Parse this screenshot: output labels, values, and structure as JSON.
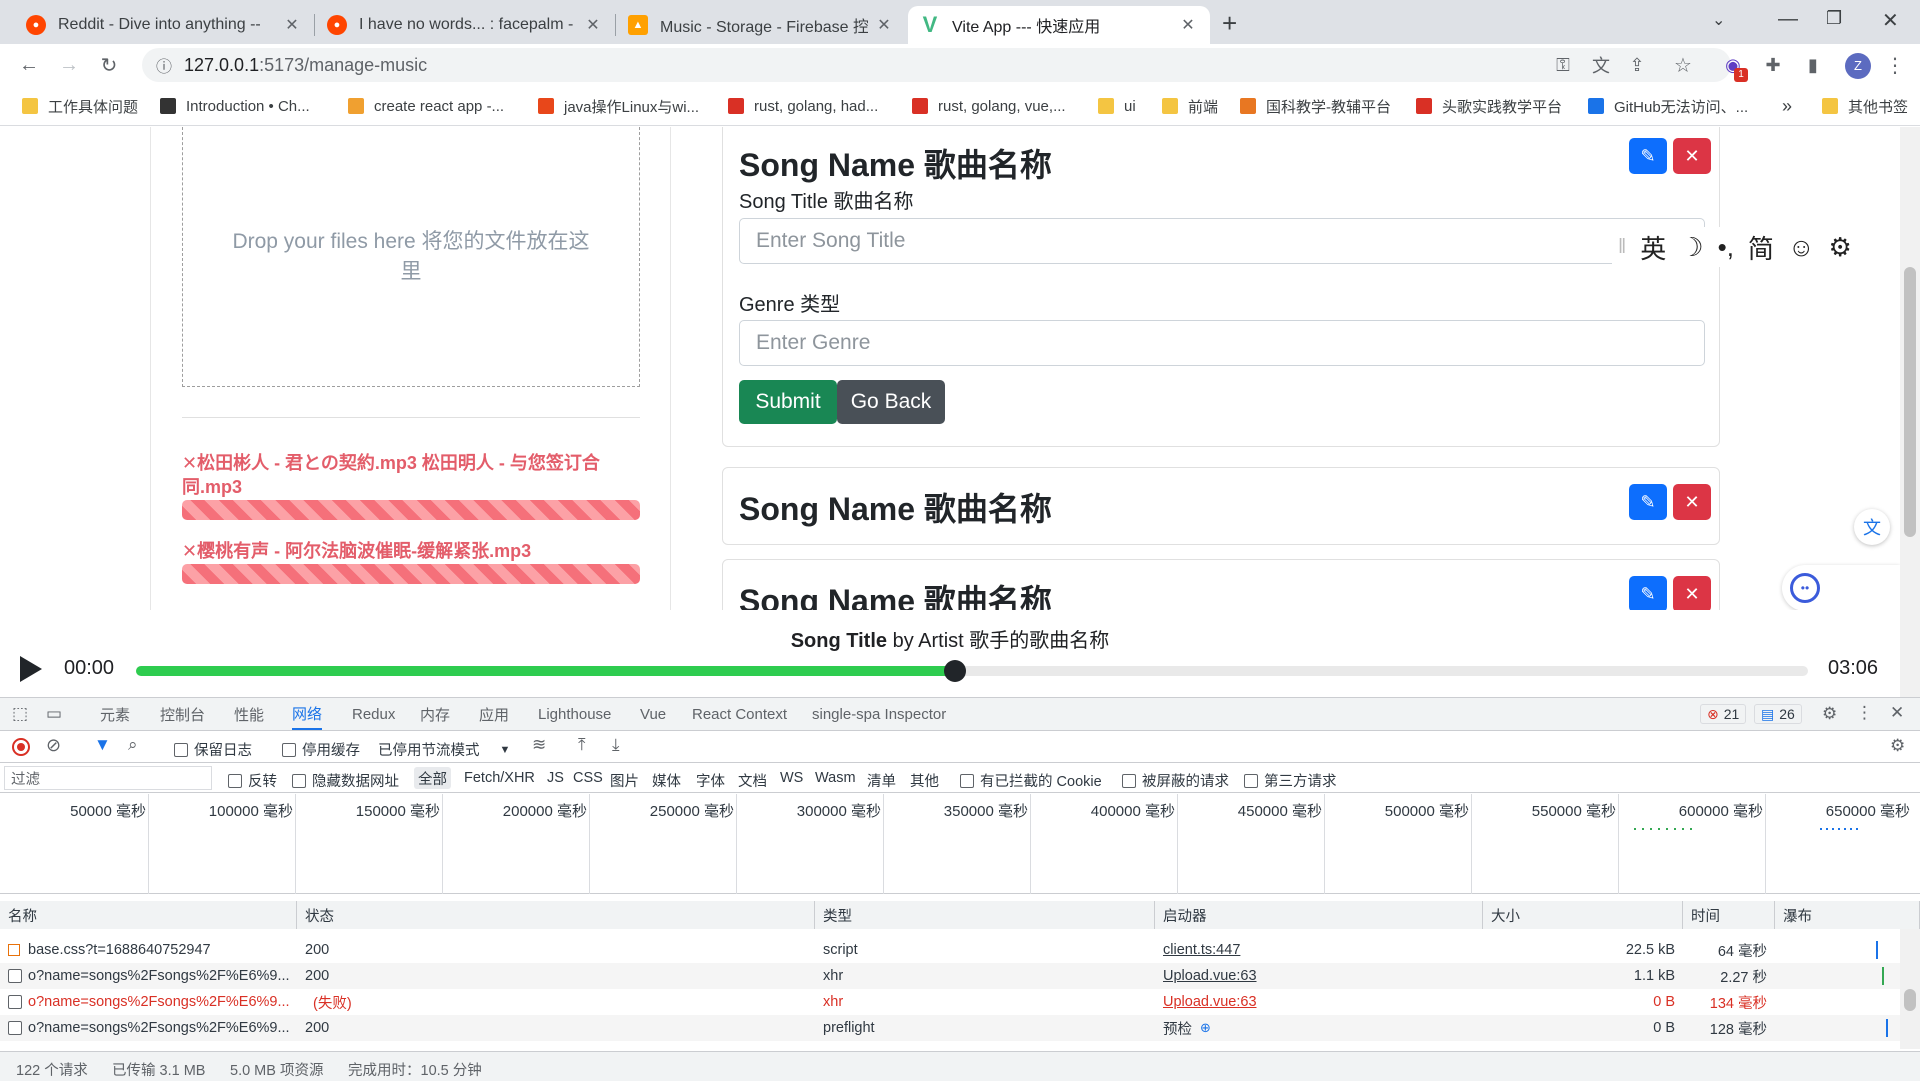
{
  "browser": {
    "tabs": [
      {
        "title": "Reddit - Dive into anything --",
        "color": "#ff4500",
        "active": false
      },
      {
        "title": "I have no words... : facepalm -",
        "color": "#ff4500",
        "active": false
      },
      {
        "title": "Music - Storage - Firebase 控制",
        "color": "#ffa000",
        "active": false
      },
      {
        "title": "Vite App --- 快速应用",
        "color": "#42b883",
        "active": true
      }
    ],
    "url_host": "127.0.0.1",
    "url_path": ":5173/manage-music",
    "ext_badge": "1",
    "profile_initial": "Z",
    "bookmarks": [
      {
        "label": "工作具体问题",
        "color": "#f4c542"
      },
      {
        "label": "Introduction • Ch...",
        "color": "#333333"
      },
      {
        "label": "create react app -...",
        "color": "#f0a030"
      },
      {
        "label": "java操作Linux与wi...",
        "color": "#e8471a"
      },
      {
        "label": "rust, golang, had...",
        "color": "#d93025"
      },
      {
        "label": "rust, golang, vue,...",
        "color": "#d93025"
      },
      {
        "label": "ui",
        "color": "#f4c542"
      },
      {
        "label": "前端",
        "color": "#f4c542"
      },
      {
        "label": "国科教学-教辅平台",
        "color": "#e87722"
      },
      {
        "label": "头歌实践教学平台",
        "color": "#d93025"
      },
      {
        "label": "GitHub无法访问、...",
        "color": "#1a73e8"
      },
      {
        "label": "其他书签",
        "color": "#f4c542"
      }
    ],
    "more_bookmarks": "»"
  },
  "page": {
    "dropzone_text": "Drop your files here 将您的文件放在这里",
    "uploads": [
      {
        "name": "✕松田彬人 - 君との契約.mp3  松田明人 - 与您签订合同.mp3"
      },
      {
        "name": "✕樱桃有声 - 阿尔法脑波催眠-缓解紧张.mp3"
      }
    ],
    "cards": [
      {
        "title": "Song Name 歌曲名称",
        "song_title_label": "Song Title 歌曲名称",
        "song_title_placeholder": "Enter Song Title",
        "genre_label": "Genre 类型",
        "genre_placeholder": "Enter Genre",
        "submit_label": "Submit",
        "back_label": "Go Back"
      },
      {
        "title": "Song Name 歌曲名称"
      },
      {
        "title": "Song Name 歌曲名称"
      }
    ],
    "ime_items": [
      "英",
      "☽",
      "•,",
      "简",
      "☺",
      "⚙"
    ]
  },
  "player": {
    "now_playing_title": "Song Title",
    "now_playing_rest": " by Artist 歌手的歌曲名称",
    "current_time": "00:00",
    "duration": "03:06",
    "progress": 0.49
  },
  "devtools": {
    "tabs": [
      "元素",
      "控制台",
      "性能",
      "网络",
      "Redux",
      "内存",
      "应用",
      "Lighthouse",
      "Vue",
      "React Context",
      "single-spa Inspector"
    ],
    "active_tab": "网络",
    "errors": "21",
    "messages": "26",
    "toolbar": {
      "preserve_log": "保留日志",
      "disable_cache": "停用缓存",
      "throttle": "已停用节流模式"
    },
    "filter": {
      "placeholder": "过滤",
      "invert": "反转",
      "hide_data_urls": "隐藏数据网址",
      "types": [
        "全部",
        "Fetch/XHR",
        "JS",
        "CSS",
        "图片",
        "媒体",
        "字体",
        "文档",
        "WS",
        "Wasm",
        "清单",
        "其他"
      ],
      "blocked_cookies": "有已拦截的 Cookie",
      "blocked_requests": "被屏蔽的请求",
      "third_party": "第三方请求"
    },
    "timeline_ticks": [
      "50000 毫秒",
      "100000 毫秒",
      "150000 毫秒",
      "200000 毫秒",
      "250000 毫秒",
      "300000 毫秒",
      "350000 毫秒",
      "400000 毫秒",
      "450000 毫秒",
      "500000 毫秒",
      "550000 毫秒",
      "600000 毫秒",
      "650000 毫秒"
    ],
    "columns": [
      "名称",
      "状态",
      "类型",
      "启动器",
      "大小",
      "时间",
      "瀑布"
    ],
    "rows": [
      {
        "name": "base.css?t=1688640752947",
        "status": "200",
        "type": "script",
        "initiator": "client.ts:447",
        "size": "22.5 kB",
        "time": "64 毫秒",
        "fail": false
      },
      {
        "name": "o?name=songs%2Fsongs%2F%E6%9...",
        "status": "200",
        "type": "xhr",
        "initiator": "Upload.vue:63",
        "size": "1.1 kB",
        "time": "2.27 秒",
        "fail": false
      },
      {
        "name": "o?name=songs%2Fsongs%2F%E6%9...",
        "status": "(失败)",
        "type": "xhr",
        "initiator": "Upload.vue:63",
        "size": "0 B",
        "time": "134 毫秒",
        "fail": true
      },
      {
        "name": "o?name=songs%2Fsongs%2F%E6%9...",
        "status": "200",
        "type": "preflight",
        "initiator": "预检",
        "size": "0 B",
        "time": "128 毫秒",
        "fail": false
      }
    ],
    "status_bar": {
      "requests": "122 个请求",
      "transferred": "已传输 3.1 MB",
      "resources": "5.0 MB 项资源",
      "finish": "完成用时：10.5 分钟"
    }
  }
}
